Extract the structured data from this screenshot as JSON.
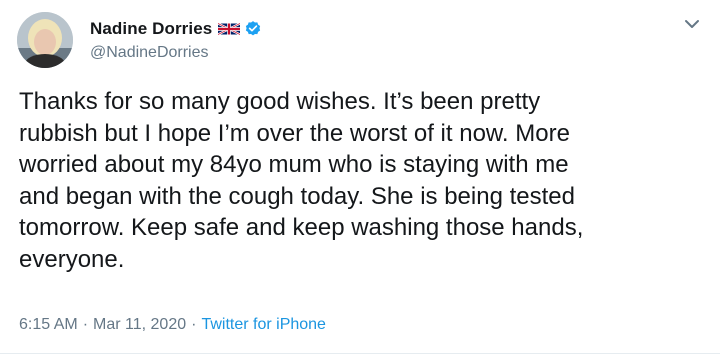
{
  "author": {
    "display_name": "Nadine Dorries",
    "handle": "@NadineDorries",
    "flag_icon": "uk-flag-icon",
    "verified_icon": "verified-badge-icon",
    "avatar_icon": "profile-photo"
  },
  "tweet": {
    "text": "Thanks for so many good wishes. It’s been pretty\nrubbish but I hope I’m over the worst of it now. More\nworried about my 84yo mum who is staying with me\nand began with the cough today. She is being tested\ntomorrow. Keep safe and keep washing those hands,\neveryone.",
    "time": "6:15 AM",
    "separator": "·",
    "date": "Mar 11, 2020",
    "source": "Twitter for iPhone"
  },
  "menu": {
    "icon": "chevron-down-icon"
  },
  "colors": {
    "text": "#14171a",
    "secondary": "#657786",
    "link": "#1b95e0",
    "verified": "#1da1f2"
  }
}
